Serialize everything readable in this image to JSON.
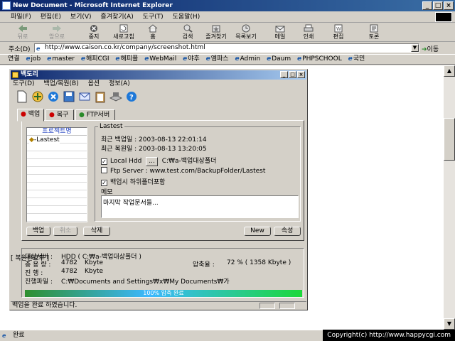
{
  "window": {
    "title": "New Document - Microsoft Internet Explorer",
    "controls": [
      "_",
      "□",
      "×"
    ]
  },
  "menu": [
    "파일(F)",
    "편집(E)",
    "보기(V)",
    "즐겨찾기(A)",
    "도구(T)",
    "도움말(H)"
  ],
  "toolbar": {
    "back": "뒤로",
    "forward": "앞으로",
    "stop": "중지",
    "refresh": "새로고침",
    "home": "홈",
    "search": "검색",
    "favorites": "즐겨찾기",
    "history": "목록보기",
    "mail": "메일",
    "print": "인쇄",
    "edit": "편집",
    "discuss": "토론"
  },
  "address": {
    "label": "주소(D)",
    "url": "http://www.caison.co.kr/company/screenshot.html",
    "go": "이동"
  },
  "links": {
    "label": "연결",
    "items": [
      "job",
      "master",
      "해피CGI",
      "해피플",
      "WebMail",
      "야후",
      "엠파스",
      "Admin",
      "Daum",
      "PHPSCHOOL",
      "국민"
    ]
  },
  "app": {
    "title": "백도리",
    "menu": [
      "도구(D)",
      "백업/복원(B)",
      "옵션",
      "정보(A)"
    ],
    "tabs": [
      "백업",
      "복구",
      "FTP서버"
    ],
    "project_header": "프로젝트명",
    "project_items": [
      "-Lastest"
    ],
    "group_title": "Lastest",
    "last_backup": "최근 백업일 : 2003-08-13 22:01:14",
    "last_restore": "최근 복원일 : 2003-08-13 13:20:05",
    "local_hdd_label": "Local Hdd",
    "local_hdd_browse": "...",
    "local_hdd_path": "C:₩a-백업대상폴더",
    "ftp_label": "Ftp Server : www.test.com/BackupFolder/Lastest",
    "include_subfolders": "백업시 하위폴더포함",
    "memo_label": "메모",
    "memo_text": "마지막 작업문서들...",
    "buttons": {
      "backup": "백업",
      "cancel": "취소",
      "delete": "삭제",
      "new": "New",
      "properties": "속성"
    },
    "info": {
      "target_label": "대상서버 :",
      "target_value": "HDD ( C:₩a-백업대상폴더 )",
      "total_label": "총 용 량 :",
      "total_value": "4782",
      "total_unit": "Kbyte",
      "progress_label": "진    행 :",
      "progress_value": "4782",
      "progress_unit": "Kbyte",
      "compress_label": "압축율 :",
      "compress_value": "72   % ( 1358 Kbyte )",
      "file_label": "진행파일 :",
      "file_value": "C:₩Documents and Settings₩x₩My Documents₩가"
    },
    "progress": {
      "fraction": 1.0,
      "text": "100% 압축 완료"
    },
    "status": "백업을 완료 하였습니다."
  },
  "page_text": "[ 복원완료후 ]",
  "statusbar": "완료",
  "copyright": "Copyright(c) http://www.happycgi.com"
}
